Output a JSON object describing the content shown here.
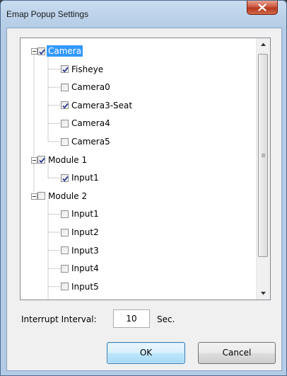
{
  "window": {
    "title": "Emap Popup Settings"
  },
  "tree": [
    {
      "label": "Camera",
      "checked": true,
      "selected": true,
      "level": 0
    },
    {
      "label": "Fisheye",
      "checked": true,
      "level": 1
    },
    {
      "label": "Camera0",
      "checked": false,
      "level": 1
    },
    {
      "label": "Camera3-Seat",
      "checked": true,
      "level": 1
    },
    {
      "label": "Camera4",
      "checked": false,
      "level": 1
    },
    {
      "label": "Camera5",
      "checked": false,
      "level": 1
    },
    {
      "label": "Module 1",
      "checked": true,
      "level": 0
    },
    {
      "label": "Input1",
      "checked": true,
      "level": 1
    },
    {
      "label": "Module 2",
      "checked": false,
      "level": 0
    },
    {
      "label": "Input1",
      "checked": false,
      "level": 1
    },
    {
      "label": "Input2",
      "checked": false,
      "level": 1
    },
    {
      "label": "Input3",
      "checked": false,
      "level": 1
    },
    {
      "label": "Input4",
      "checked": false,
      "level": 1
    },
    {
      "label": "Input5",
      "checked": false,
      "level": 1
    }
  ],
  "interval": {
    "label": "Interrupt Interval:",
    "value": "10",
    "unit": "Sec."
  },
  "buttons": {
    "ok": "OK",
    "cancel": "Cancel"
  }
}
